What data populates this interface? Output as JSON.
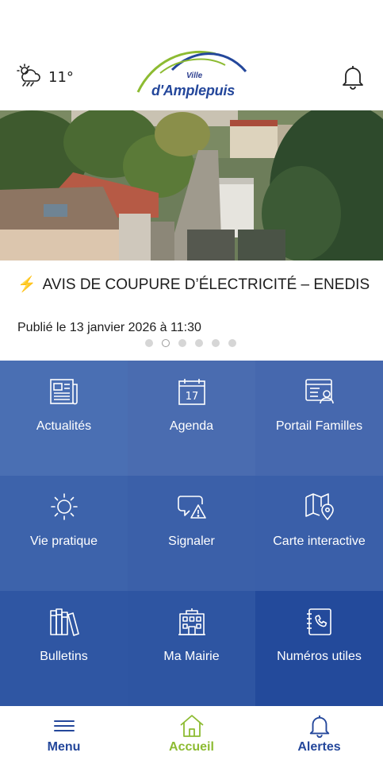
{
  "header": {
    "weather_icon": "cloud-rain-sun-icon",
    "temperature": "11°",
    "logo_small": "Ville",
    "logo_name": "d'Amplepuis",
    "notification_icon": "bell-icon"
  },
  "news": {
    "title": "AVIS DE COUPURE D’ÉLECTRICITÉ – ENEDIS",
    "published": "Publié le 13 janvier 2026 à 11:30",
    "carousel_count": 6,
    "carousel_active": 2
  },
  "tiles": [
    {
      "label": "Actualités",
      "icon": "newspaper-icon"
    },
    {
      "label": "Agenda",
      "icon": "calendar-icon"
    },
    {
      "label": "Portail Familles",
      "icon": "family-portal-icon"
    },
    {
      "label": "Vie pratique",
      "icon": "sun-icon"
    },
    {
      "label": "Signaler",
      "icon": "report-warning-icon"
    },
    {
      "label": "Carte interactive",
      "icon": "map-pin-icon"
    },
    {
      "label": "Bulletins",
      "icon": "books-icon"
    },
    {
      "label": "Ma Mairie",
      "icon": "town-hall-icon"
    },
    {
      "label": "Numéros utiles",
      "icon": "phone-book-icon"
    }
  ],
  "bottom_nav": [
    {
      "label": "Menu",
      "icon": "hamburger-icon",
      "color": "#24479b"
    },
    {
      "label": "Accueil",
      "icon": "home-icon",
      "color": "#8dbb32"
    },
    {
      "label": "Alertes",
      "icon": "bell-icon",
      "color": "#24479b"
    }
  ],
  "colors": {
    "brand_blue": "#24479b",
    "brand_green": "#8dbb32",
    "bolt": "#f2b400"
  }
}
